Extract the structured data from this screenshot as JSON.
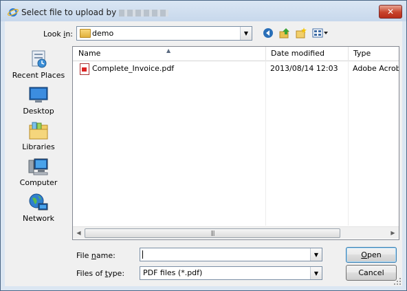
{
  "window": {
    "title": "Select file to upload by",
    "title_icon": "ie-icon",
    "close_label": "✕"
  },
  "lookin": {
    "label_prefix": "Look ",
    "label_accel": "i",
    "label_suffix": "n:",
    "value": "demo"
  },
  "toolbar": {
    "back_icon": "back-arrow-icon",
    "up_icon": "up-folder-icon",
    "new_folder_icon": "new-folder-icon",
    "views_icon": "views-menu-icon"
  },
  "places": [
    {
      "label": "Recent Places",
      "icon": "recent-places-icon"
    },
    {
      "label": "Desktop",
      "icon": "desktop-icon"
    },
    {
      "label": "Libraries",
      "icon": "libraries-icon"
    },
    {
      "label": "Computer",
      "icon": "computer-icon"
    },
    {
      "label": "Network",
      "icon": "network-icon"
    }
  ],
  "filelist": {
    "columns": [
      "Name",
      "Date modified",
      "Type"
    ],
    "rows": [
      {
        "name": "Complete_Invoice.pdf",
        "date": "2013/08/14 12:03",
        "type": "Adobe Acroba"
      }
    ]
  },
  "filename": {
    "label_prefix": "File ",
    "label_accel": "n",
    "label_suffix": "ame:",
    "value": ""
  },
  "filetype": {
    "label_prefix": "Files of ",
    "label_accel": "t",
    "label_suffix": "ype:",
    "value": "PDF files (*.pdf)"
  },
  "buttons": {
    "open_accel": "O",
    "open_rest": "pen",
    "cancel": "Cancel"
  }
}
